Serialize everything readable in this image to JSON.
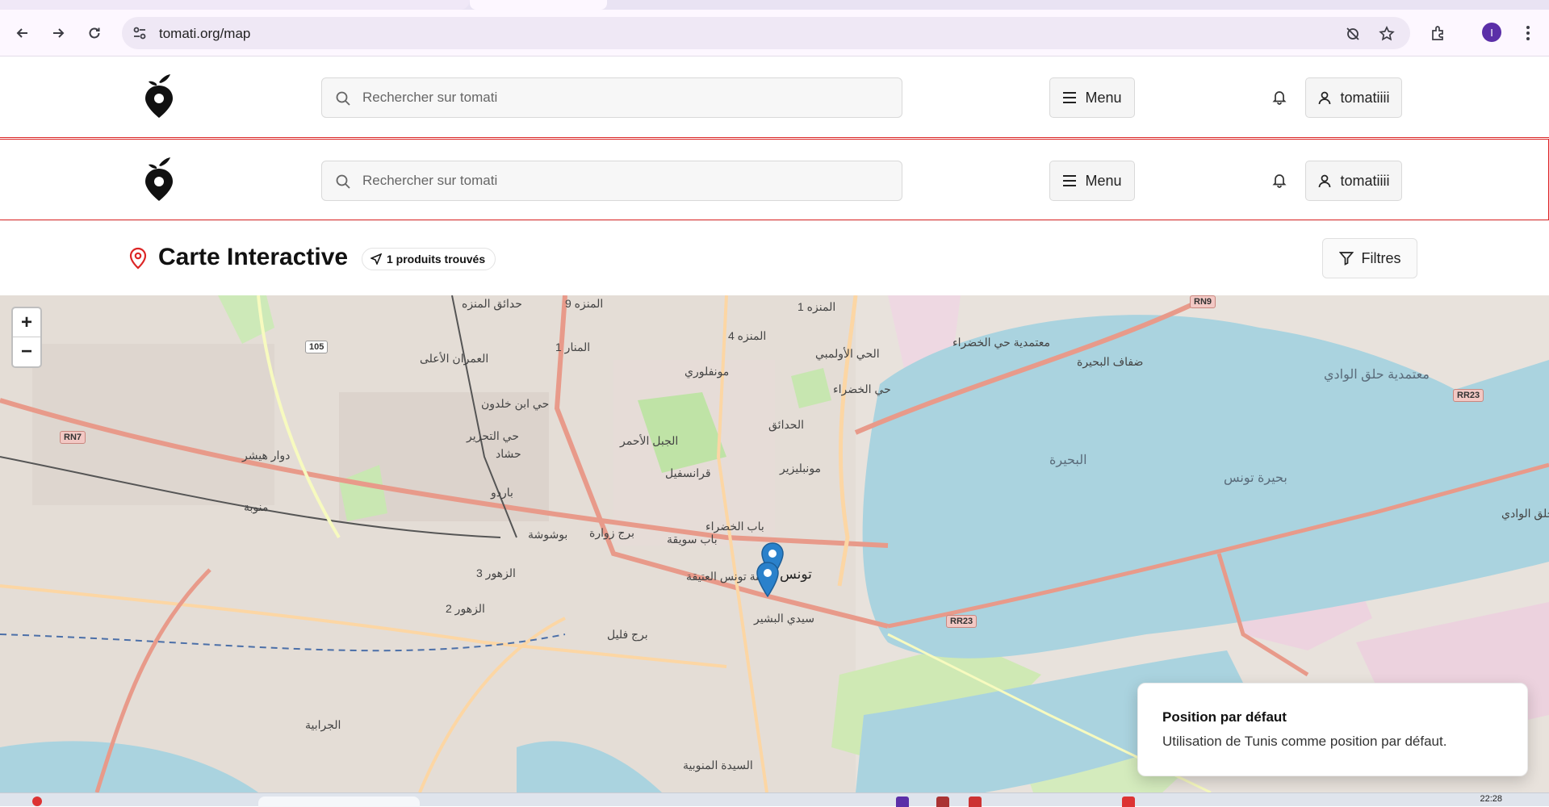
{
  "browser": {
    "url": "tomati.org/map",
    "avatar_initial": "I"
  },
  "header": {
    "search_placeholder": "Rechercher sur tomati",
    "menu_label": "Menu",
    "user_label": "tomatiiii"
  },
  "header_duplicate": {
    "search_placeholder": "Rechercher sur tomati",
    "menu_label": "Menu",
    "user_label": "tomatiiii"
  },
  "page": {
    "title": "Carte Interactive",
    "count_badge": "1 produits trouvés",
    "filters_label": "Filtres"
  },
  "map": {
    "zoom_in": "+",
    "zoom_out": "−",
    "labels": [
      "حدائق المنزه",
      "المنزه 9",
      "المنزه 1",
      "المنزه 4",
      "المنار 1",
      "دوار هيشر",
      "منوبة",
      "باردو",
      "برج زوارة",
      "الزهور 3",
      "الزهور 2",
      "حشاد",
      "الجبل الأحمر",
      "قرانسفيل",
      "مونبليزير",
      "الحدائق",
      "مونفلوري",
      "باب الخضراء",
      "باب سويقة",
      "مدينة تونس العتيقة",
      "تونس",
      "سيدي البشير",
      "الحي الأولمبي",
      "حي الخضراء",
      "بحيرة تونس",
      "البحيرة",
      "حلق الوادي",
      "ضفاف البحيرة",
      "الجرابية",
      "السيدة المنوبية",
      "حي ابن خلدون",
      "حي التحرير",
      "بوشوشة",
      "برج فليل",
      "العمران الأعلى",
      "معتمدية حلق الوادي",
      "معتمدية حي الخضراء"
    ],
    "road_shields": [
      "RN9",
      "RN7",
      "RR23",
      "RR23",
      "105"
    ]
  },
  "toast": {
    "title": "Position par défaut",
    "description": "Utilisation de Tunis comme position par défaut."
  },
  "taskbar": {
    "clock": "22:28"
  },
  "colors": {
    "accent_red": "#dc2626",
    "marker_blue": "#2a81cb",
    "water": "#aad3df",
    "avatar": "#5b2fa8"
  }
}
